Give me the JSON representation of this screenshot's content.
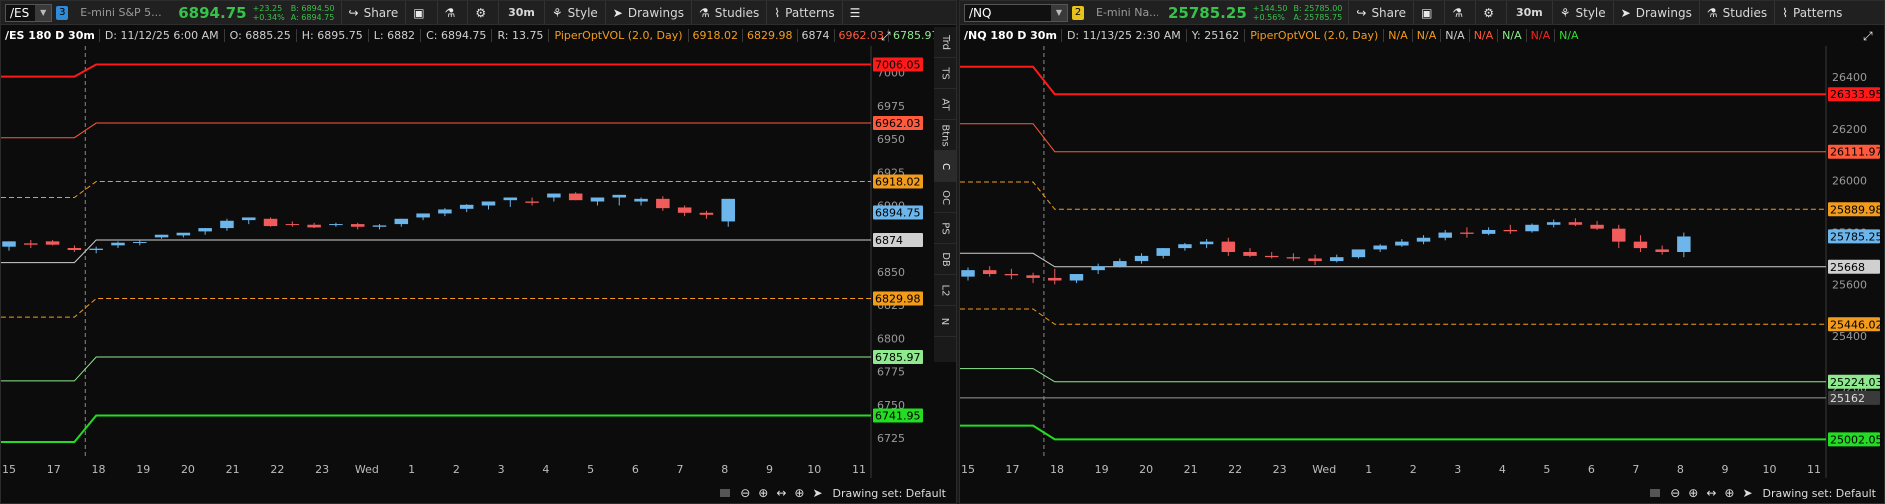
{
  "left": {
    "symbol": "/ES",
    "link_number": "3",
    "link_color": "#2f8ad8",
    "description": "E-mini S&P 5...",
    "last": "6894.75",
    "change": "+23.25",
    "change_pct": "+0.34%",
    "bid": "B: 6894.50",
    "ask": "A: 6894.75",
    "title": "/ES 180 D 30m",
    "info": {
      "date": "D: 11/12/25 6:00 AM",
      "open": "O: 6885.25",
      "high": "H: 6895.75",
      "low": "L: 6882",
      "close": "C: 6894.75",
      "range": "R: 13.75"
    },
    "study": "PiperOptVOL (2.0, Day)",
    "study_values": [
      {
        "text": "6918.02",
        "color": "#f39c1c"
      },
      {
        "text": "6829.98",
        "color": "#f39c1c"
      },
      {
        "text": "6874",
        "color": "#d0d0d0"
      },
      {
        "text": "6962.03",
        "color": "#ff5a3c"
      },
      {
        "text": "6785.97",
        "color": "#8fe98f"
      }
    ],
    "side_tabs": [
      "Trd",
      "TS",
      "AT",
      "Btns",
      "C",
      "OC",
      "PS",
      "DB",
      "L2",
      "N"
    ],
    "active_side_tab": 4
  },
  "right": {
    "symbol": "/NQ",
    "link_number": "2",
    "link_color": "#e8c21a",
    "description": "E-mini Na...",
    "last": "25785.25",
    "change": "+144.50",
    "change_pct": "+0.56%",
    "bid": "B: 25785.00",
    "ask": "A: 25785.75",
    "title": "/NQ 180 D 30m",
    "info": {
      "date": "D: 11/13/25 2:30 AM",
      "y": "Y: 25162"
    },
    "study": "PiperOptVOL (2.0, Day)",
    "study_values": [
      {
        "text": "N/A",
        "color": "#f39c1c"
      },
      {
        "text": "N/A",
        "color": "#f39c1c"
      },
      {
        "text": "N/A",
        "color": "#d0d0d0"
      },
      {
        "text": "N/A",
        "color": "#ff5a3c"
      },
      {
        "text": "N/A",
        "color": "#8fe98f"
      },
      {
        "text": "N/A",
        "color": "#ff2020"
      },
      {
        "text": "N/A",
        "color": "#2ee02e"
      }
    ]
  },
  "toolbar": {
    "share": "Share",
    "timeframe": "30m",
    "style": "Style",
    "drawings": "Drawings",
    "studies": "Studies",
    "patterns": "Patterns"
  },
  "bottom_bar": {
    "drawing_set": "Drawing set: Default"
  },
  "colors": {
    "background": "#0c0c0c",
    "up_candle": "#6cb6ec",
    "down_candle": "#f05b5b",
    "line_red": "#ff1a1a",
    "line_orange_red": "#ff5a3c",
    "line_orange": "#f39c1c",
    "line_center": "#d0d0d0",
    "line_lightgreen": "#8fe98f",
    "line_green": "#22dd22"
  },
  "chart_data": [
    {
      "type": "candlestick",
      "title": "/ES 180 D 30m",
      "ylim": [
        6710,
        7020
      ],
      "y_ticks": [
        6725,
        6750,
        6775,
        6800,
        6825,
        6850,
        6875,
        6900,
        6925,
        6950,
        6975,
        7000
      ],
      "x_tick_labels": [
        "15",
        "17",
        "18",
        "19",
        "20",
        "21",
        "22",
        "23",
        "Wed",
        "1",
        "2",
        "3",
        "4",
        "5",
        "6",
        "7",
        "8",
        "9",
        "10",
        "11"
      ],
      "x_range": [
        15,
        34.5
      ],
      "session_break_x": 16.5,
      "candles": {
        "x": [
          15,
          15.5,
          16,
          16.5,
          17,
          17.5,
          18,
          18.5,
          19,
          19.5,
          20,
          20.5,
          21,
          21.5,
          22,
          22.5,
          23,
          23.5,
          24,
          24.5,
          25,
          25.5,
          26,
          26.5,
          27,
          27.5,
          28,
          28.5,
          29,
          29.5,
          30,
          30.5,
          31,
          31.5
        ],
        "open": [
          6869,
          6871.5,
          6873,
          6868,
          6866.5,
          6870,
          6872,
          6876,
          6877.5,
          6880.5,
          6883,
          6889,
          6890,
          6886,
          6885.5,
          6886,
          6886,
          6884,
          6886,
          6891,
          6894,
          6897.5,
          6900,
          6904,
          6903,
          6906,
          6909,
          6903,
          6906,
          6903,
          6905,
          6898.5,
          6894.5,
          6888
        ],
        "high": [
          6873,
          6874,
          6874,
          6870,
          6869,
          6873,
          6874,
          6878,
          6879,
          6883,
          6890,
          6891,
          6891,
          6888,
          6887,
          6887,
          6887,
          6886,
          6890,
          6894,
          6898,
          6901,
          6903,
          6906,
          6906,
          6909,
          6910,
          6906,
          6908,
          6906,
          6907,
          6900,
          6896,
          6905
        ],
        "low": [
          6866,
          6868,
          6870,
          6865,
          6864,
          6868,
          6870,
          6875,
          6876,
          6878,
          6881,
          6886,
          6884,
          6884,
          6883,
          6884,
          6882,
          6882,
          6884,
          6889,
          6892,
          6895,
          6897,
          6899,
          6900,
          6903,
          6904,
          6900,
          6900,
          6900,
          6896,
          6892,
          6890,
          6884
        ],
        "close": [
          6873,
          6870.5,
          6870.5,
          6866.5,
          6867.5,
          6872,
          6872.5,
          6878,
          6879.5,
          6883,
          6888.5,
          6891,
          6884.5,
          6885.5,
          6883.5,
          6886,
          6884,
          6885,
          6890,
          6894,
          6897,
          6900.5,
          6903,
          6906,
          6902,
          6909,
          6904,
          6906,
          6908,
          6905,
          6898,
          6894.5,
          6893,
          6905
        ]
      },
      "levels": [
        {
          "name": "upper-2",
          "pre_x": 16.5,
          "pre": 6997,
          "post": 7006.05,
          "color": "#ff1a1a",
          "label": "7006.05"
        },
        {
          "name": "upper-1",
          "pre_x": 16.5,
          "pre": 6951,
          "post": 6962.03,
          "color": "#ff5a3c",
          "label": "6962.03"
        },
        {
          "name": "upper-half",
          "pre_x": 16.5,
          "pre": 6906,
          "post": 6918.02,
          "color": "#f39c1c",
          "dashed": true,
          "label": "6918.02"
        },
        {
          "name": "center",
          "pre_x": 16.5,
          "pre": 6857,
          "post": 6874,
          "color": "#d0d0d0",
          "label": "6874"
        },
        {
          "name": "lower-half",
          "pre_x": 16.5,
          "pre": 6816,
          "post": 6829.98,
          "color": "#f39c1c",
          "dashed": true,
          "label": "6829.98"
        },
        {
          "name": "lower-1",
          "pre_x": 16.5,
          "pre": 6768,
          "post": 6785.97,
          "color": "#8fe98f",
          "label": "6785.97"
        },
        {
          "name": "lower-2",
          "pre_x": 16.5,
          "pre": 6722,
          "post": 6741.95,
          "color": "#22dd22",
          "label": "6741.95"
        }
      ],
      "last_price": {
        "value": 6894.75,
        "label": "6894.75"
      }
    },
    {
      "type": "candlestick",
      "title": "/NQ 180 D 30m",
      "ylim": [
        24930,
        26520
      ],
      "y_ticks": [
        25200,
        25400,
        25600,
        25800,
        26000,
        26200,
        26400
      ],
      "x_tick_labels": [
        "15",
        "17",
        "18",
        "19",
        "20",
        "21",
        "22",
        "23",
        "Wed",
        "1",
        "2",
        "3",
        "4",
        "5",
        "6",
        "7",
        "8",
        "9",
        "10",
        "11"
      ],
      "x_range": [
        15,
        34.5
      ],
      "session_break_x": 16.5,
      "candles": {
        "x": [
          15,
          15.5,
          16,
          16.5,
          17,
          17.5,
          18,
          18.5,
          19,
          19.5,
          20,
          20.5,
          21,
          21.5,
          22,
          22.5,
          23,
          23.5,
          24,
          24.5,
          25,
          25.5,
          26,
          26.5,
          27,
          27.5,
          28,
          28.5,
          29,
          29.5,
          30,
          30.5,
          31,
          31.5
        ],
        "open": [
          25630,
          25655,
          25640,
          25635,
          25625,
          25615,
          25655,
          25670,
          25690,
          25710,
          25740,
          25755,
          25765,
          25725,
          25710,
          25705,
          25700,
          25690,
          25705,
          25735,
          25750,
          25765,
          25780,
          25800,
          25795,
          25810,
          25805,
          25830,
          25840,
          25830,
          25815,
          25765,
          25735,
          25725
        ],
        "high": [
          25665,
          25670,
          25660,
          25645,
          25660,
          25640,
          25680,
          25700,
          25720,
          25740,
          25760,
          25775,
          25780,
          25740,
          25725,
          25720,
          25715,
          25715,
          25735,
          25755,
          25775,
          25790,
          25810,
          25820,
          25820,
          25830,
          25835,
          25850,
          25855,
          25845,
          25830,
          25790,
          25750,
          25800
        ],
        "low": [
          25615,
          25630,
          25620,
          25605,
          25600,
          25605,
          25640,
          25665,
          25680,
          25700,
          25730,
          25740,
          25710,
          25705,
          25700,
          25690,
          25675,
          25685,
          25700,
          25725,
          25745,
          25755,
          25770,
          25780,
          25790,
          25795,
          25800,
          25820,
          25825,
          25810,
          25740,
          25725,
          25715,
          25705
        ],
        "close": [
          25655,
          25640,
          25635,
          25625,
          25615,
          25640,
          25670,
          25690,
          25710,
          25740,
          25755,
          25765,
          25725,
          25710,
          25705,
          25700,
          25690,
          25705,
          25735,
          25750,
          25765,
          25780,
          25800,
          25795,
          25810,
          25805,
          25830,
          25840,
          25830,
          25815,
          25765,
          25740,
          25725,
          25785
        ]
      },
      "levels": [
        {
          "name": "upper-2",
          "pre_x": 16.5,
          "pre": 26440,
          "post": 26333.95,
          "color": "#ff1a1a",
          "label": "26333.95"
        },
        {
          "name": "upper-1",
          "pre_x": 16.5,
          "pre": 26220,
          "post": 26111.97,
          "color": "#ff5a3c",
          "label": "26111.97"
        },
        {
          "name": "upper-half",
          "pre_x": 16.5,
          "pre": 25995,
          "post": 25889.98,
          "color": "#f39c1c",
          "dashed": true,
          "label": "25889.98"
        },
        {
          "name": "center",
          "pre_x": 16.5,
          "pre": 25720,
          "post": 25668,
          "color": "#d0d0d0",
          "label": "25668"
        },
        {
          "name": "lower-half",
          "pre_x": 16.5,
          "pre": 25505,
          "post": 25446.02,
          "color": "#f39c1c",
          "dashed": true,
          "label": "25446.02"
        },
        {
          "name": "lower-1",
          "pre_x": 16.5,
          "pre": 25275,
          "post": 25224.03,
          "color": "#8fe98f",
          "label": "25224.03"
        },
        {
          "name": "lower-2",
          "pre_x": 16.5,
          "pre": 25055,
          "post": 25002.05,
          "color": "#22dd22",
          "label": "25002.05"
        }
      ],
      "crosshair": {
        "value": 25162,
        "label": "25162"
      },
      "last_price": {
        "value": 25785.25,
        "label": "25785.25"
      }
    }
  ]
}
